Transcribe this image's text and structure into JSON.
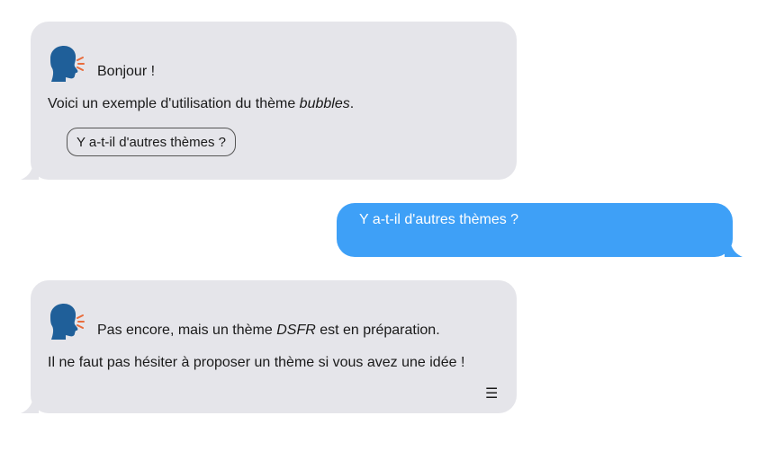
{
  "bot_message_1": {
    "greeting": "Bonjour !",
    "intro_before": "Voici un exemple d'utilisation du thème ",
    "intro_theme": "bubbles",
    "intro_after": ".",
    "choice_label": "Y a-t-il d'autres thèmes ?"
  },
  "user_message": {
    "text": "Y a-t-il d'autres thèmes ?"
  },
  "bot_message_2": {
    "line1_before": "Pas encore, mais un thème ",
    "line1_theme": "DSFR",
    "line1_after": " est en préparation.",
    "line2": "Il ne faut pas hésiter à proposer un thème si vous avez une idée !",
    "menu_glyph": "☰"
  },
  "colors": {
    "bot_bubble": "#e5e5ea",
    "user_bubble": "#3ea0f7",
    "avatar_head": "#1f5f99",
    "avatar_sound": "#e96c3c"
  },
  "icons": {
    "avatar": "speaking-head-icon",
    "menu": "hamburger-menu-icon"
  }
}
